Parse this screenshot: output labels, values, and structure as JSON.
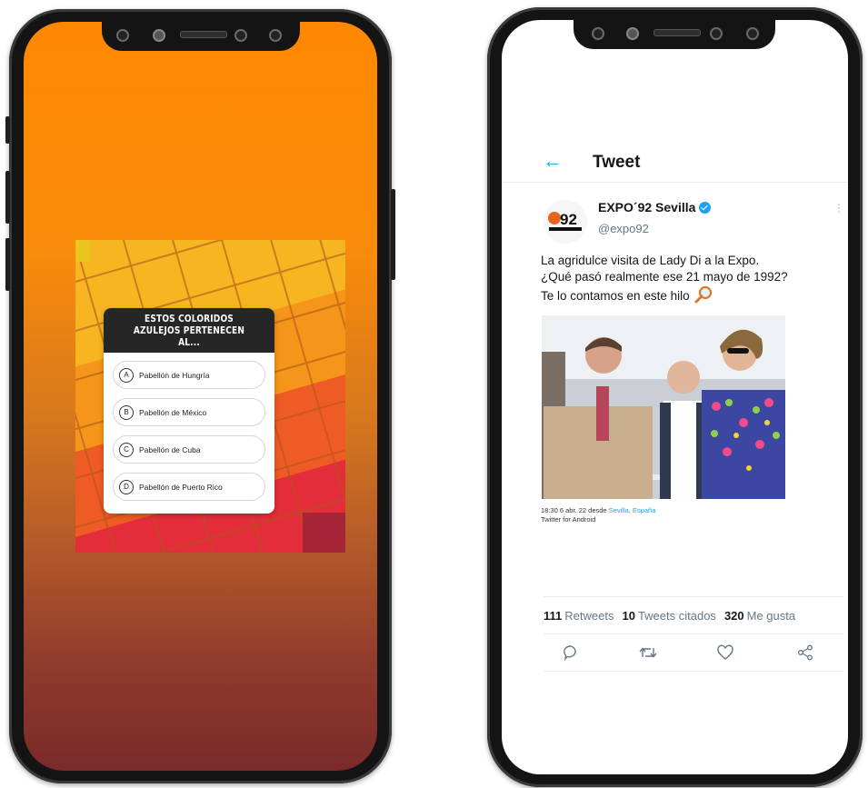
{
  "quiz": {
    "title": "ESTOS COLORIDOS AZULEJOS PERTENECEN AL...",
    "options": [
      {
        "letter": "A",
        "label": "Pabellón de Hungría"
      },
      {
        "letter": "B",
        "label": "Pabellón de México"
      },
      {
        "letter": "C",
        "label": "Pabellón de Cuba"
      },
      {
        "letter": "D",
        "label": "Pabellón de Puerto Rico"
      }
    ]
  },
  "tweet": {
    "header_title": "Tweet",
    "account_name": "EXPO´92 Sevilla",
    "handle": "@expo92",
    "avatar_text": "92",
    "text_lines": [
      "La agridulce visita de Lady Di a la Expo.",
      "¿Qué pasó realmente ese 21 mayo de 1992?",
      "Te lo contamos en este hilo"
    ],
    "time": "18:30",
    "date": "6 abr. 22",
    "from_label": "desde",
    "location": "Sevilla, España",
    "client": "Twitter for Android",
    "stats": {
      "retweets_count": "111",
      "retweets_label": "Retweets",
      "quotes_count": "10",
      "quotes_label": "Tweets citados",
      "likes_count": "320",
      "likes_label": "Me gusta"
    },
    "icons": [
      "reply-icon",
      "retweet-icon",
      "like-icon",
      "share-icon"
    ],
    "accent_color": "#1da1f2"
  }
}
